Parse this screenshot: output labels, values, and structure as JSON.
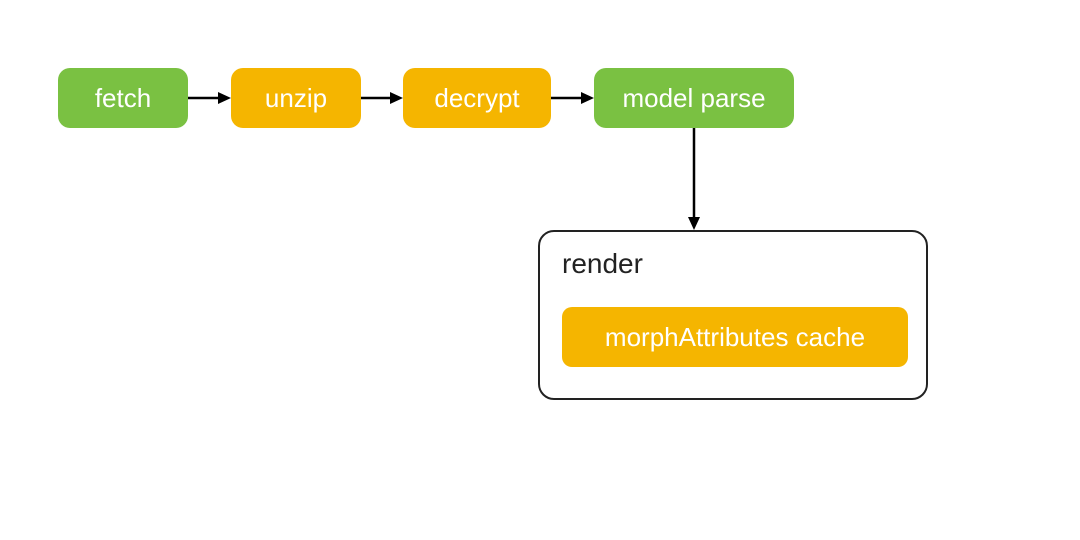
{
  "nodes": {
    "fetch": {
      "label": "fetch",
      "color": "green"
    },
    "unzip": {
      "label": "unzip",
      "color": "orange"
    },
    "decrypt": {
      "label": "decrypt",
      "color": "orange"
    },
    "model_parse": {
      "label": "model parse",
      "color": "green"
    }
  },
  "container": {
    "title": "render",
    "inner": {
      "label": "morphAttributes cache",
      "color": "orange"
    }
  },
  "edges": [
    {
      "from": "fetch",
      "to": "unzip"
    },
    {
      "from": "unzip",
      "to": "decrypt"
    },
    {
      "from": "decrypt",
      "to": "model_parse"
    },
    {
      "from": "model_parse",
      "to": "render_container"
    }
  ],
  "colors": {
    "green": "#7ac142",
    "orange": "#f5b500",
    "arrow": "#000000",
    "border": "#222222",
    "text_dark": "#222222",
    "text_light": "#ffffff"
  }
}
